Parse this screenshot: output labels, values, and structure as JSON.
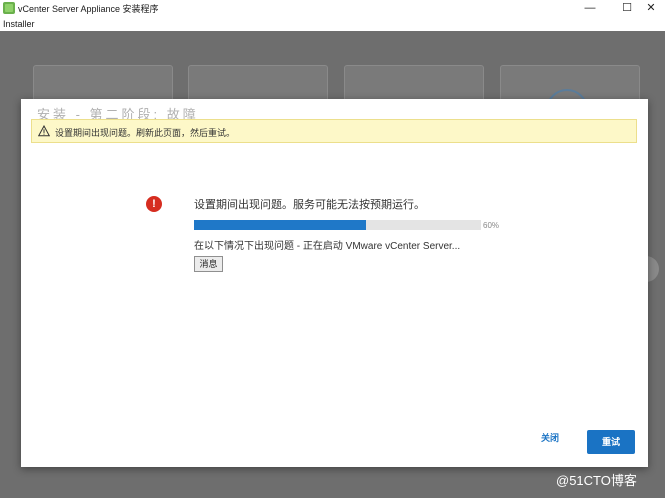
{
  "window": {
    "title": "vCenter Server Appliance 安装程序",
    "controls": {
      "minimize": "—",
      "maximize": "☐",
      "close": "✕"
    }
  },
  "menu": {
    "installer": "Installer"
  },
  "modal": {
    "title_faded": "安装 - 第二阶段: 故障",
    "warning_banner": "设置期间出现问题。刷新此页面，然后重试。",
    "error_headline": "设置期间出现问题。服务可能无法按预期运行。",
    "progress": {
      "percent": 60,
      "label": "60%"
    },
    "status_text": "在以下情况下出现问题 - 正在启动 VMware vCenter Server...",
    "message_button": "消息",
    "close_button": "关闭",
    "retry_button": "重试"
  },
  "background": {
    "next_arrow": "›"
  },
  "watermark": "@51CTO博客",
  "colors": {
    "accent": "#1a73c4",
    "progress_fill": "#1f78c8",
    "error_red": "#d62d20",
    "warning_bg": "#fdf8c8",
    "overlay": "#6e6e6e",
    "app_icon": "#6ab04c"
  },
  "icons": [
    "vsphere-app-icon",
    "warning-triangle-icon",
    "error-exclamation-icon",
    "chevron-right-icon"
  ]
}
